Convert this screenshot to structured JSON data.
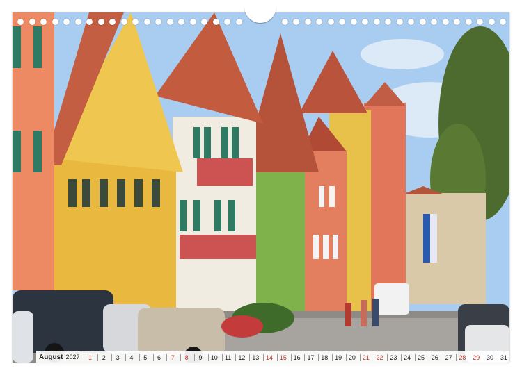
{
  "calendar": {
    "month": "August",
    "year": "2027",
    "days": [
      {
        "n": "1",
        "we": true
      },
      {
        "n": "2",
        "we": false
      },
      {
        "n": "3",
        "we": false
      },
      {
        "n": "4",
        "we": false
      },
      {
        "n": "5",
        "we": false
      },
      {
        "n": "6",
        "we": false
      },
      {
        "n": "7",
        "we": true
      },
      {
        "n": "8",
        "we": true
      },
      {
        "n": "9",
        "we": false
      },
      {
        "n": "10",
        "we": false
      },
      {
        "n": "11",
        "we": false
      },
      {
        "n": "12",
        "we": false
      },
      {
        "n": "13",
        "we": false
      },
      {
        "n": "14",
        "we": true
      },
      {
        "n": "15",
        "we": true
      },
      {
        "n": "16",
        "we": false
      },
      {
        "n": "17",
        "we": false
      },
      {
        "n": "18",
        "we": false
      },
      {
        "n": "19",
        "we": false
      },
      {
        "n": "20",
        "we": false
      },
      {
        "n": "21",
        "we": true
      },
      {
        "n": "22",
        "we": true
      },
      {
        "n": "23",
        "we": false
      },
      {
        "n": "24",
        "we": false
      },
      {
        "n": "25",
        "we": false
      },
      {
        "n": "26",
        "we": false
      },
      {
        "n": "27",
        "we": false
      },
      {
        "n": "28",
        "we": true
      },
      {
        "n": "29",
        "we": true
      },
      {
        "n": "30",
        "we": false
      },
      {
        "n": "31",
        "we": false
      }
    ]
  },
  "colors": {
    "sky": "#9cc3e8",
    "weekend_red": "#c0392b"
  }
}
